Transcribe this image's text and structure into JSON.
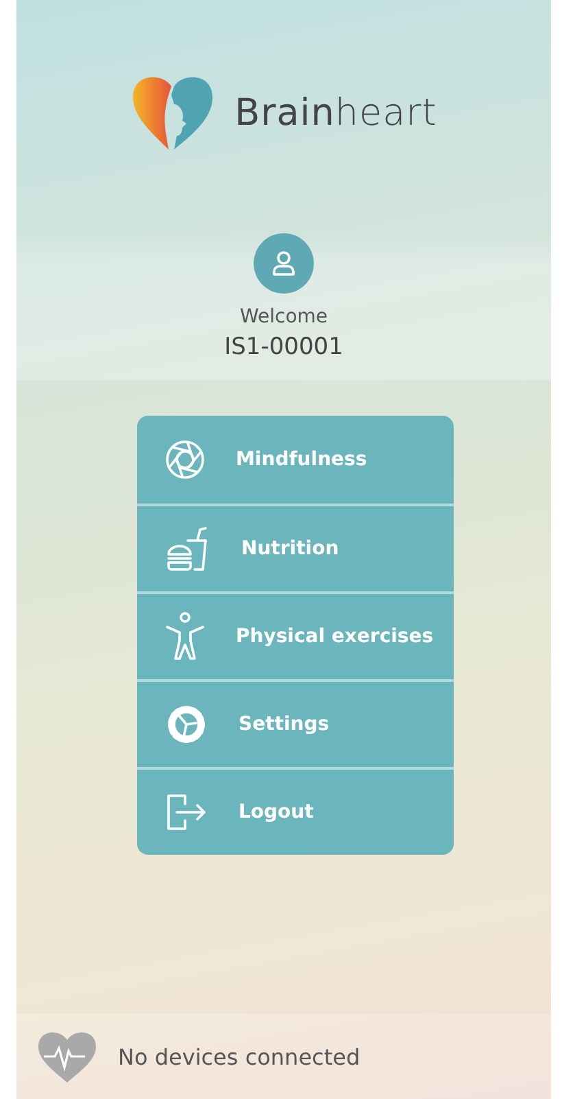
{
  "logo": {
    "text": "**Brain**heart"
  },
  "user": {
    "greeting": "Welcome",
    "id": "IS1-00001"
  },
  "menu": [
    {
      "kind": "aperture",
      "label": "Mindfulness"
    },
    {
      "kind": "food",
      "label": "Nutrition"
    },
    {
      "kind": "person",
      "label": "Physical exercises"
    },
    {
      "kind": "gear",
      "label": "Settings"
    },
    {
      "kind": "logout",
      "label": "Logout"
    }
  ],
  "status_bar": {
    "text": "No devices connected"
  }
}
